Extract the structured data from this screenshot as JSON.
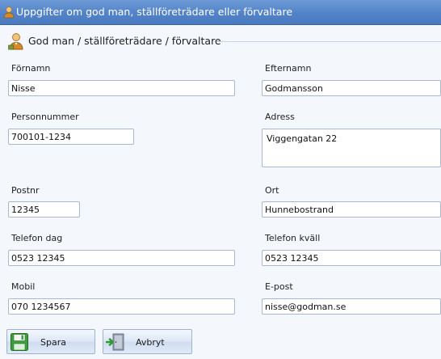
{
  "window": {
    "title": "Uppgifter om god man, ställföreträdare eller förvaltare",
    "title_icon": "person-icon"
  },
  "group": {
    "title": "God man / ställföreträdare / förvaltare",
    "icon": "person-icon"
  },
  "form": {
    "firstname": {
      "label": "Förnamn",
      "value": "Nisse"
    },
    "lastname": {
      "label": "Efternamn",
      "value": "Godmansson"
    },
    "personnummer": {
      "label": "Personnummer",
      "value": "700101-1234"
    },
    "address": {
      "label": "Adress",
      "value": "Viggengatan 22"
    },
    "postnr": {
      "label": "Postnr",
      "value": "12345"
    },
    "city": {
      "label": "Ort",
      "value": "Hunnebostrand"
    },
    "phone_day": {
      "label": "Telefon dag",
      "value": "0523 12345"
    },
    "phone_evening": {
      "label": "Telefon kväll",
      "value": "0523 12345"
    },
    "mobile": {
      "label": "Mobil",
      "value": "070 1234567"
    },
    "email": {
      "label": "E-post",
      "value": "nisse@godman.se"
    }
  },
  "buttons": {
    "save": {
      "label": "Spara",
      "icon": "floppy-disk-icon"
    },
    "cancel": {
      "label": "Avbryt",
      "icon": "exit-door-icon"
    }
  },
  "colors": {
    "titlebar": "#5283c8",
    "panel": "#f4f7fc",
    "field_border": "#a9b8cf"
  }
}
